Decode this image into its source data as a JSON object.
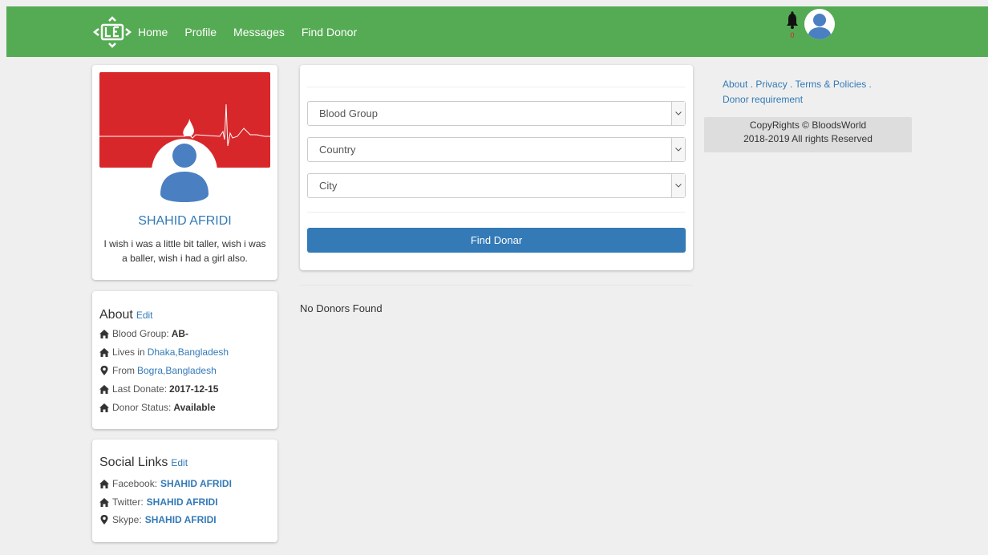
{
  "nav": {
    "links": [
      "Home",
      "Profile",
      "Messages",
      "Find Donor"
    ],
    "notification_count": "0",
    "bar_color": "#55ab53"
  },
  "profile": {
    "name": "SHAHID AFRIDI",
    "bio": "I wish i was a little bit taller, wish i was a baller, wish i had a girl also."
  },
  "about": {
    "title": "About",
    "edit_label": "Edit",
    "blood_group_label": "Blood Group:",
    "blood_group": "AB-",
    "lives_label": "Lives in",
    "lives_value": "Dhaka,Bangladesh",
    "from_label": "From",
    "from_value": "Bogra,Bangladesh",
    "last_donate_label": "Last Donate:",
    "last_donate": "2017-12-15",
    "status_label": "Donor Status:",
    "status": "Available"
  },
  "social": {
    "title": "Social Links",
    "edit_label": "Edit",
    "facebook_label": "Facebook:",
    "facebook": "SHAHID AFRIDI",
    "twitter_label": "Twitter:",
    "twitter": "SHAHID AFRIDI",
    "skype_label": "Skype:",
    "skype": "SHAHID AFRIDI"
  },
  "search": {
    "blood_group_selected": "Blood Group",
    "country_selected": "Country",
    "city_selected": "City",
    "button_label": "Find Donar",
    "result_text": "No Donors Found"
  },
  "footer": {
    "about": "About",
    "privacy": "Privacy",
    "terms": "Terms & Policies",
    "donor_req": "Donor requirement",
    "copyright_line1": "CopyRights © BloodsWorld",
    "copyright_line2": "2018-2019 All rights Reserved"
  },
  "colors": {
    "brand_green": "#55ab53",
    "cover_red": "#d8272a",
    "primary_blue": "#337ab7",
    "avatar_blue": "#4a7fc1"
  }
}
